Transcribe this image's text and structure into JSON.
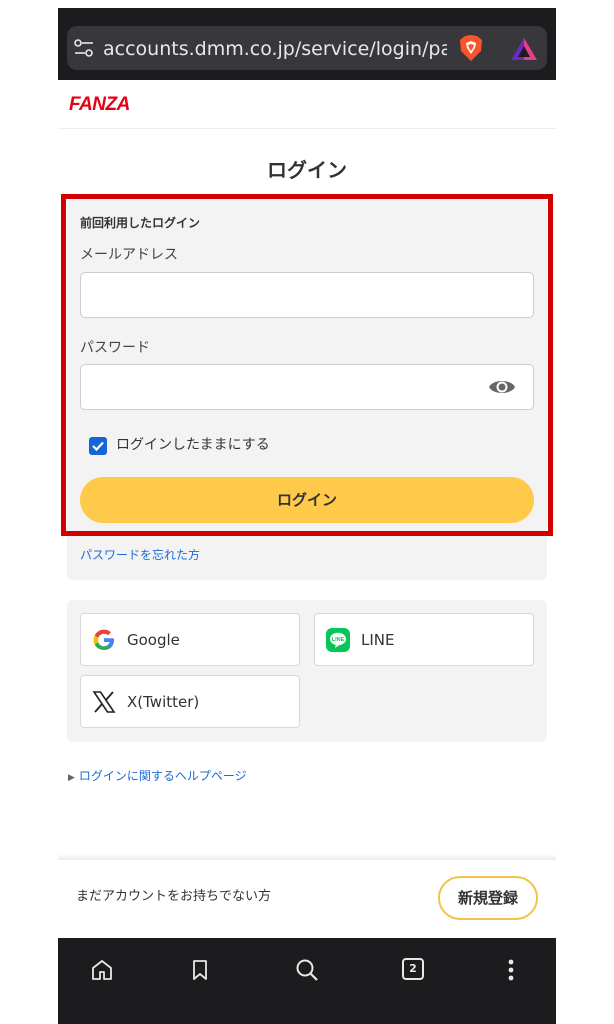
{
  "browser": {
    "url": "accounts.dmm.co.jp/service/login/password",
    "tab_count": "2"
  },
  "header": {
    "logo": "FANZA"
  },
  "login": {
    "title": "ログイン",
    "previous_login_label": "前回利用したログイン",
    "email_label": "メールアドレス",
    "email_value": "",
    "password_label": "パスワード",
    "password_value": "",
    "keep_logged_in_label": "ログインしたままにする",
    "keep_logged_in_checked": true,
    "submit_label": "ログイン",
    "forgot_password": "パスワードを忘れた方"
  },
  "social": {
    "items": [
      {
        "label": "Google",
        "icon": "google-icon"
      },
      {
        "label": "LINE",
        "icon": "line-icon"
      },
      {
        "label": "X(Twitter)",
        "icon": "x-icon"
      }
    ]
  },
  "help": {
    "link": "ログインに関するヘルプページ"
  },
  "footer": {
    "no_account_text": "まだアカウントをお持ちでない方",
    "register_label": "新規登録"
  },
  "colors": {
    "accent_button": "#ffc94a",
    "highlight_border": "#d40000",
    "link": "#1a6bd6",
    "brand": "#e60012"
  }
}
